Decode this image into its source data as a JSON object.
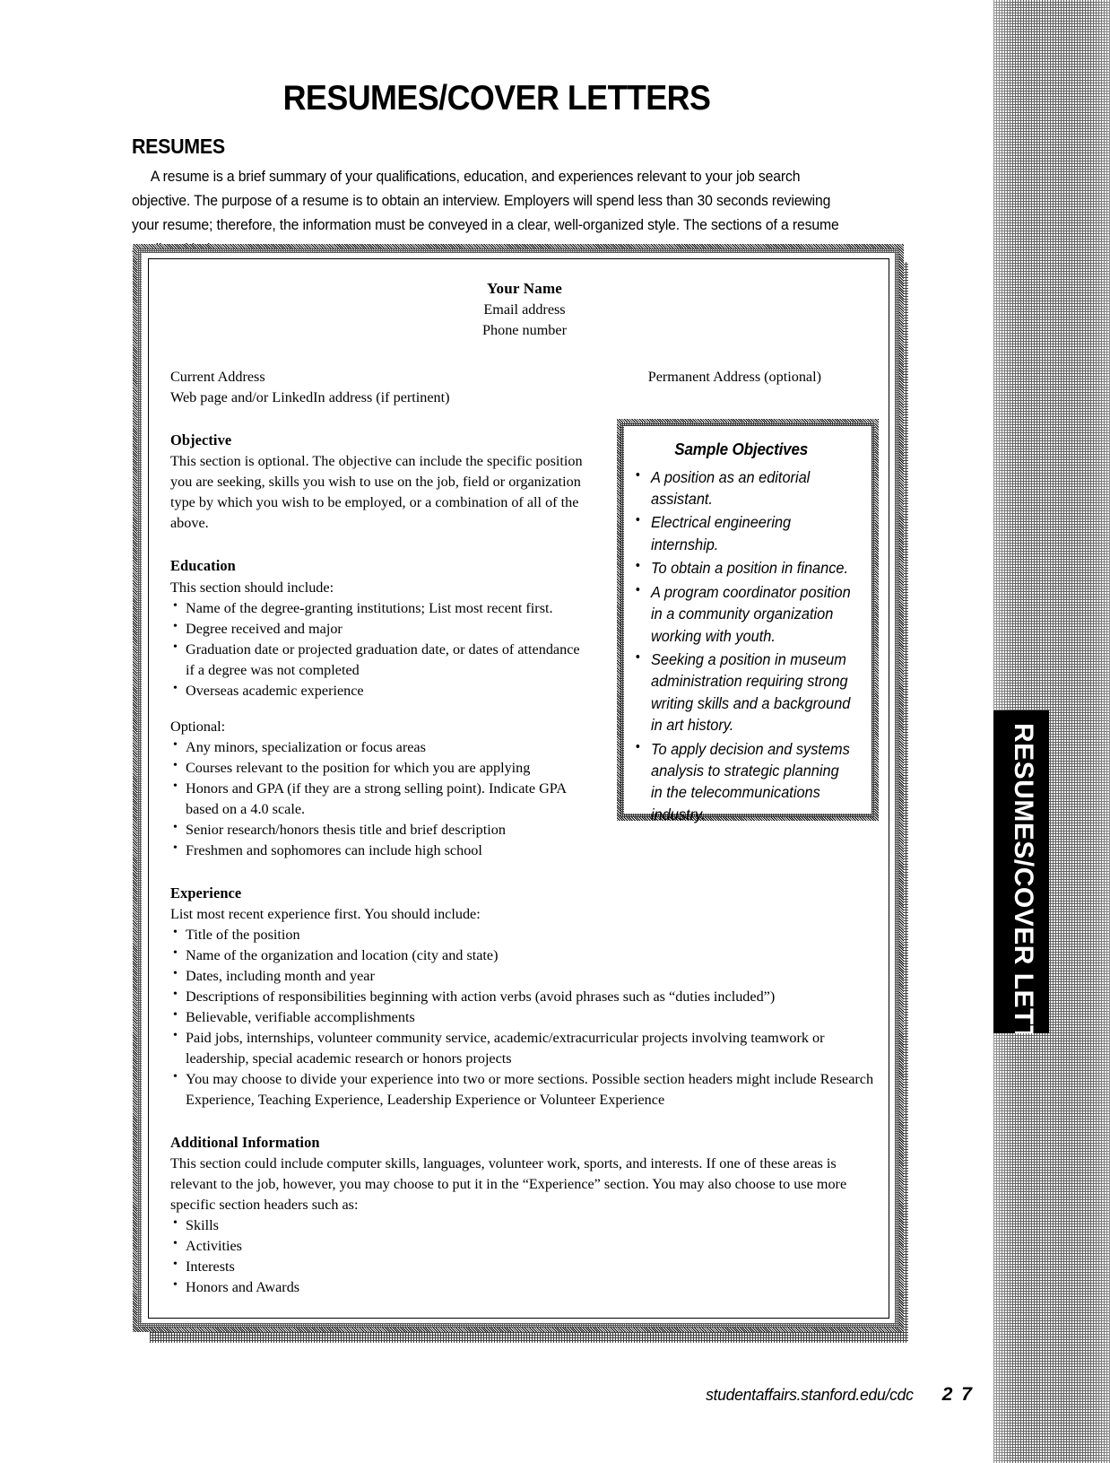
{
  "page": {
    "title": "RESUMES/COVER LETTERS",
    "side_tab_label": "RESUMES/COVER LETTERS"
  },
  "intro": {
    "heading": "RESUMES",
    "body": "A resume is a brief summary of your qualifications, education, and experiences relevant to your job search objective. The purpose of a resume is to obtain an interview. Employers will spend less than 30 seconds reviewing your resume; therefore, the information must be conveyed in a clear, well-organized style. The sections of a resume are listed below."
  },
  "resume_sample": {
    "header": {
      "name": "Your Name",
      "email": "Email address",
      "phone": "Phone number"
    },
    "address": {
      "current": "Current Address",
      "webpage": "Web page and/or LinkedIn address (if pertinent)",
      "permanent": "Permanent Address (optional)"
    },
    "objective": {
      "title": "Objective",
      "body": "This section is optional. The objective can include the specific position you are seeking, skills you wish to use on the job, field or organization type by which you wish to be employed, or a combination of all of the above."
    },
    "education": {
      "title": "Education",
      "intro": "This section should include:",
      "items": [
        "Name of the degree-granting institutions; List most recent first.",
        "Degree received and major",
        "Graduation date or projected graduation date, or dates of attendance if a degree was not completed",
        "Overseas academic experience"
      ],
      "optional_label": "Optional:",
      "optional_items": [
        "Any minors, specialization or focus areas",
        "Courses relevant to the position for which you are applying",
        "Honors and GPA (if they are a strong selling point). Indicate GPA based on a 4.0 scale.",
        "Senior research/honors thesis title and brief description",
        "Freshmen and sophomores can include high school"
      ]
    },
    "experience": {
      "title": "Experience",
      "intro": "List most recent experience first. You should include:",
      "items": [
        "Title of the position",
        "Name of the organization and location (city and state)",
        "Dates, including month and year",
        "Descriptions of responsibilities beginning with action verbs (avoid phrases such as “duties included”)",
        "Believable, verifiable accomplishments",
        "Paid jobs, internships, volunteer community service, academic/extracurricular projects involving teamwork or leadership, special academic research or honors projects",
        "You may choose to divide your experience into two or more sections. Possible section headers might include Research Experience, Teaching Experience, Leadership Experience or Volunteer Experience"
      ]
    },
    "additional_information": {
      "title": "Additional Information",
      "body": "This section could include computer skills, languages, volunteer work, sports, and interests. If one of these areas is relevant to the job, however, you may choose to put it in the “Experience” section. You may also choose to use more specific section headers such as:",
      "items": [
        "Skills",
        "Activities",
        "Interests",
        "Honors and Awards"
      ]
    }
  },
  "sample_objectives": {
    "title": "Sample Objectives",
    "items": [
      "A position as an editorial assistant.",
      "Electrical engineering internship.",
      "To obtain a position in finance.",
      "A program coordinator position in a community organization working with youth.",
      "Seeking a position in museum administration requiring strong writing skills and a background in art history.",
      "To apply decision and systems analysis to strategic planning in the telecommunications industry."
    ]
  },
  "footer": {
    "url": "studentaffairs.stanford.edu/cdc",
    "page_number": "2 7"
  },
  "colors": {
    "ink": "#000000",
    "paper": "#ffffff",
    "tab_background": "#000000",
    "tab_text": "#ffffff"
  }
}
